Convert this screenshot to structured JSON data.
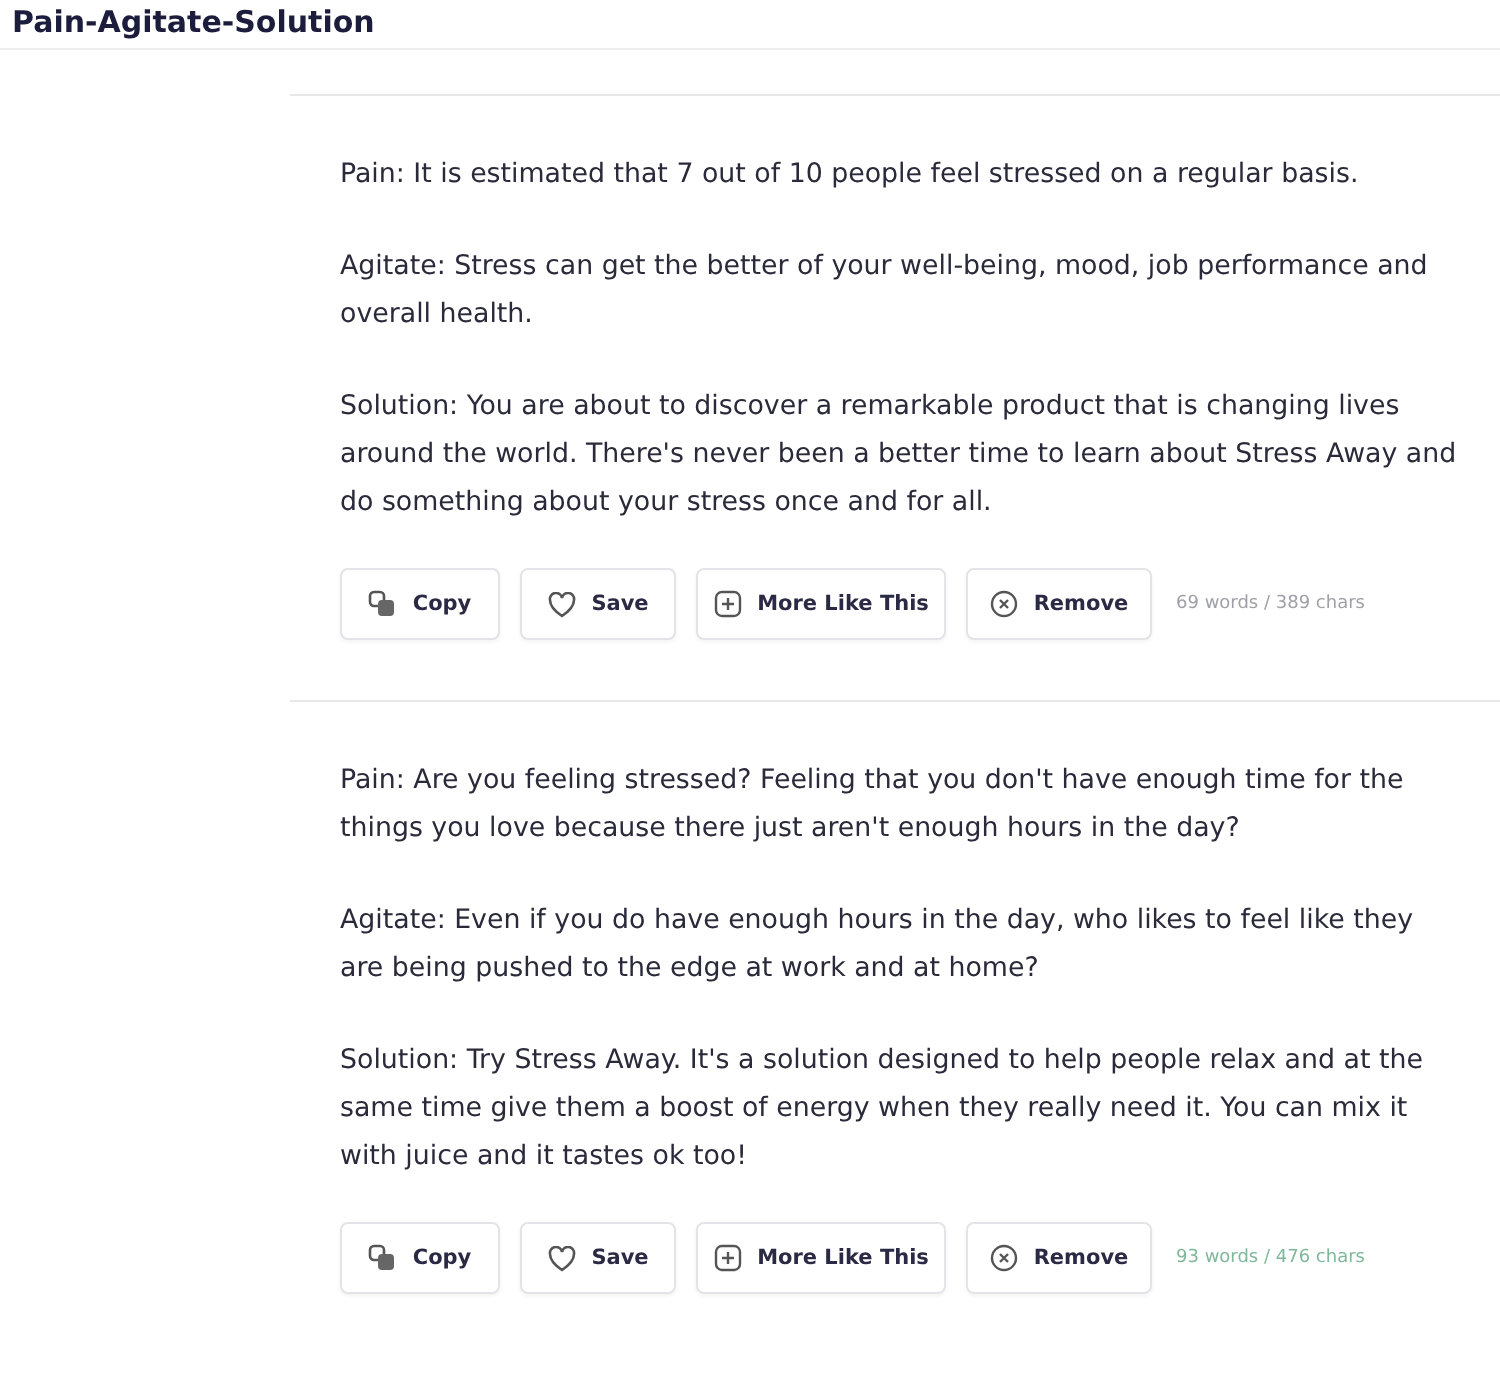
{
  "title": "Pain-Agitate-Solution",
  "results": [
    {
      "paragraphs": [
        "Pain: It is estimated that 7 out of 10 people feel stressed on a regular basis.",
        "Agitate: Stress can get the better of your well-being, mood, job performance and overall health.",
        "Solution: You are about to discover a remarkable product that is changing lives around the world. There's never been a better time to learn about Stress Away and do something about your stress once and for all."
      ],
      "buttons": [
        {
          "kind": "copy",
          "label": "Copy"
        },
        {
          "kind": "save",
          "label": "Save"
        },
        {
          "kind": "more",
          "label": "More Like This"
        },
        {
          "kind": "remove",
          "label": "Remove"
        }
      ],
      "stats": "69 words / 389 chars",
      "color": "#a0a0a8"
    },
    {
      "paragraphs": [
        "Pain: Are you feeling stressed? Feeling that you don't have enough time for the things you love because there just aren't enough hours in the day?",
        "Agitate: Even if you do have enough hours in the day, who likes to feel like they are being pushed to the edge at work and at home?",
        "Solution: Try Stress Away. It's a solution designed to help people relax and at the same time give them a boost of energy when they really need it. You can mix it with juice and it tastes ok too!"
      ],
      "buttons": [
        {
          "kind": "copy",
          "label": "Copy"
        },
        {
          "kind": "save",
          "label": "Save"
        },
        {
          "kind": "more",
          "label": "More Like This"
        },
        {
          "kind": "remove",
          "label": "Remove"
        }
      ],
      "stats": "93 words / 476 chars",
      "color": "#7fb89a"
    }
  ]
}
